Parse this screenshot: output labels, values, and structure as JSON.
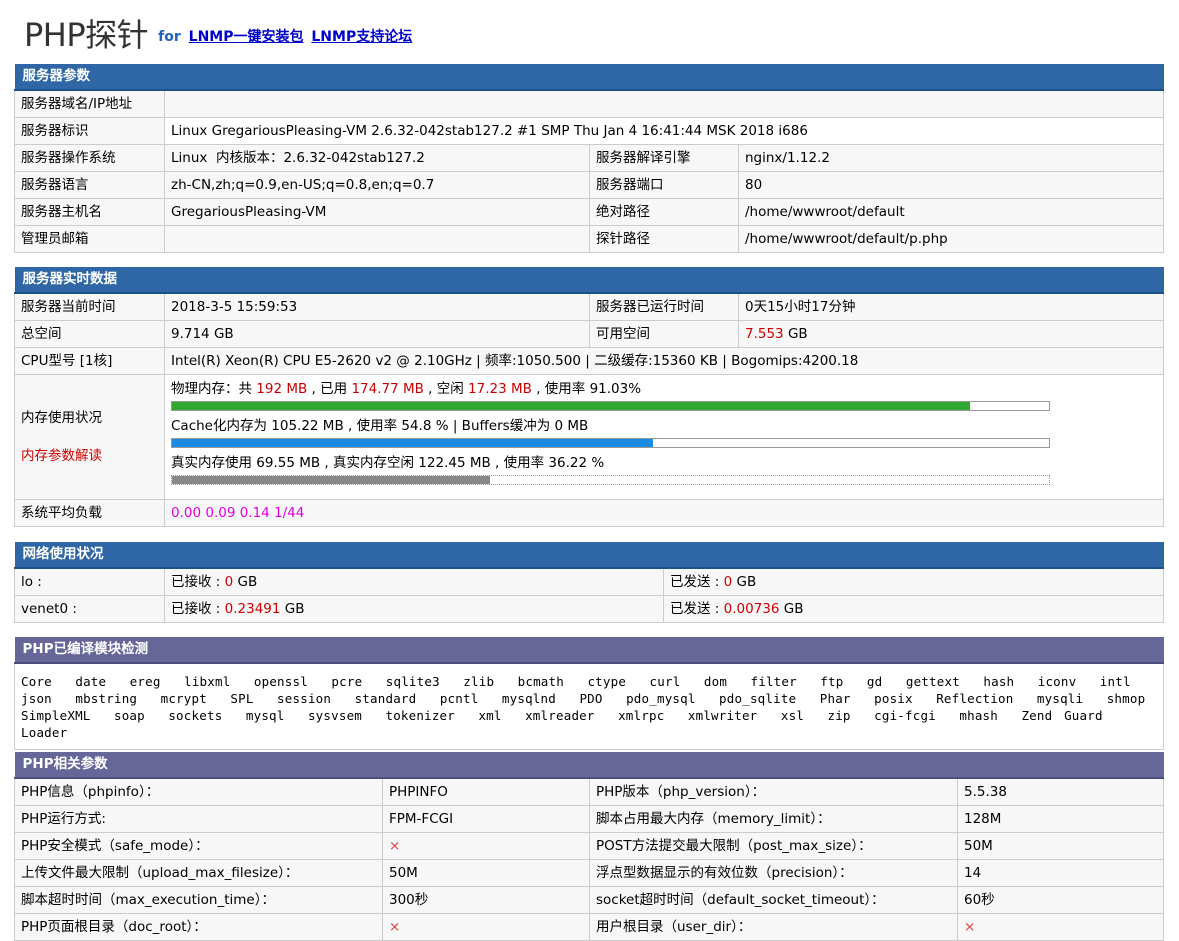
{
  "header": {
    "logo": "PHP探针",
    "for_text": "for",
    "link1": "LNMP一键安装包",
    "link2": "LNMP支持论坛"
  },
  "server_params": {
    "title": "服务器参数",
    "domain_label": "服务器域名/IP地址",
    "ident_label": "服务器标识",
    "ident_value": "Linux GregariousPleasing-VM 2.6.32-042stab127.2 #1 SMP Thu Jan 4 16:41:44 MSK 2018 i686",
    "os_label": "服务器操作系统",
    "os_value": "Linux  内核版本：2.6.32-042stab127.2",
    "engine_label": "服务器解译引擎",
    "engine_value": "nginx/1.12.2",
    "lang_label": "服务器语言",
    "lang_value": "zh-CN,zh;q=0.9,en-US;q=0.8,en;q=0.7",
    "port_label": "服务器端口",
    "port_value": "80",
    "host_label": "服务器主机名",
    "host_value": "GregariousPleasing-VM",
    "abs_label": "绝对路径",
    "abs_value": "/home/wwwroot/default",
    "admin_label": "管理员邮箱",
    "admin_value": "",
    "probe_label": "探针路径",
    "probe_value": "/home/wwwroot/default/p.php"
  },
  "realtime": {
    "title": "服务器实时数据",
    "time_label": "服务器当前时间",
    "time_value": "2018-3-5 15:59:53",
    "uptime_label": "服务器已运行时间",
    "uptime_value": "0天15小时17分钟",
    "total_label": "总空间",
    "total_value": "9.714 GB",
    "avail_label": "可用空间",
    "avail_num": "7.553",
    "avail_unit": " GB",
    "cpu_label": "CPU型号 [1核]",
    "cpu_value": "Intel(R) Xeon(R) CPU E5-2620 v2 @ 2.10GHz | 频率:1050.500 | 二级缓存:15360 KB | Bogomips:4200.18",
    "mem_label": "内存使用状况",
    "mem_link": "内存参数解读",
    "phys_p1": "物理内存：共 ",
    "phys_total": "192 MB",
    "phys_p2": " , 已用 ",
    "phys_used": "174.77 MB",
    "phys_p3": " , 空闲 ",
    "phys_free": "17.23 MB",
    "phys_p4": " , 使用率 91.03%",
    "phys_pct": 91.03,
    "cache_text": "Cache化内存为 105.22 MB , 使用率 54.8 % | Buffers缓冲为 0 MB",
    "cache_pct": 54.8,
    "real_text": "真实内存使用 69.55 MB , 真实内存空闲 122.45 MB , 使用率 36.22 %",
    "real_pct": 36.22,
    "load_label": "系统平均负载",
    "load_value": "0.00 0.09 0.14 1/44"
  },
  "network": {
    "title": "网络使用状况",
    "rows": [
      {
        "iface": "lo :",
        "recv_label": "已接收 : ",
        "recv": "0",
        "sent_label": "已发送 : ",
        "sent": "0",
        "unit": " GB"
      },
      {
        "iface": "venet0 :",
        "recv_label": "已接收 : ",
        "recv": "0.23491",
        "sent_label": "已发送 : ",
        "sent": "0.00736",
        "unit": " GB"
      }
    ]
  },
  "modules": {
    "title": "PHP已编译模块检测",
    "list": "Core  date  ereg  libxml  openssl  pcre  sqlite3  zlib  bcmath  ctype  curl  dom  filter  ftp  gd  gettext  hash  iconv  intl  json  mbstring  mcrypt  SPL  session  standard  pcntl  mysqlnd  PDO  pdo_mysql  pdo_sqlite  Phar  posix  Reflection  mysqli  shmop  SimpleXML  soap  sockets  mysql  sysvsem  tokenizer  xml  xmlreader  xmlrpc  xmlwriter  xsl  zip  cgi-fcgi  mhash  Zend Guard Loader"
  },
  "php_params": {
    "title": "PHP相关参数",
    "rows": [
      {
        "l1": "PHP信息（phpinfo）：",
        "v1": "PHPINFO",
        "l2": "PHP版本（php_version）：",
        "v2": "5.5.38"
      },
      {
        "l1": "PHP运行方式:",
        "v1": "FPM-FCGI",
        "l2": "脚本占用最大内存（memory_limit）：",
        "v2": "128M"
      },
      {
        "l1": "PHP安全模式（safe_mode）：",
        "v1": "×",
        "l2": "POST方法提交最大限制（post_max_size）：",
        "v2": "50M"
      },
      {
        "l1": "上传文件最大限制（upload_max_filesize）：",
        "v1": "50M",
        "l2": "浮点型数据显示的有效位数（precision）：",
        "v2": "14"
      },
      {
        "l1": "脚本超时时间（max_execution_time）：",
        "v1": "300秒",
        "l2": "socket超时时间（default_socket_timeout）：",
        "v2": "60秒"
      },
      {
        "l1": "PHP页面根目录（doc_root）：",
        "v1": "×",
        "l2": "用户根目录（user_dir）：",
        "v2": "×"
      }
    ]
  },
  "colors": {
    "header_blue": "#2f66a5",
    "header_purple": "#666699",
    "bar_green": "#2fa82f",
    "bar_blue": "#1a8be0",
    "bar_gray": "#888888"
  }
}
